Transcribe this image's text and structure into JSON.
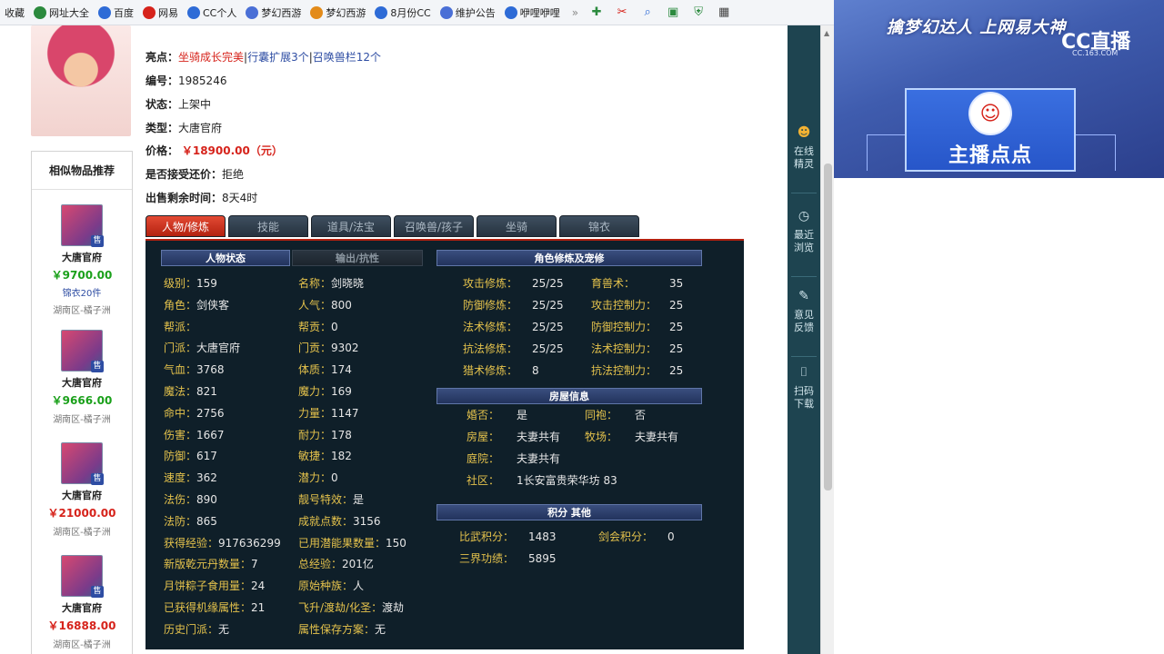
{
  "bookmarks": [
    {
      "label": "收藏",
      "icon": "star-icon",
      "color": "#888888"
    },
    {
      "label": "网址大全",
      "icon": "globe-icon",
      "color": "#2b8a3e"
    },
    {
      "label": "百度",
      "icon": "paw-icon",
      "color": "#2e6bd6"
    },
    {
      "label": "网易",
      "icon": "netease-icon",
      "color": "#d6231b"
    },
    {
      "label": "CC个人",
      "icon": "cc-icon",
      "color": "#2e6bd6"
    },
    {
      "label": "梦幻西游",
      "icon": "game-icon",
      "color": "#4a6fd6"
    },
    {
      "label": "梦幻西游",
      "icon": "game-icon",
      "color": "#e38b1a"
    },
    {
      "label": "8月份CC",
      "icon": "cc-icon",
      "color": "#2e6bd6"
    },
    {
      "label": "维护公告",
      "icon": "game-icon",
      "color": "#4a6fd6"
    },
    {
      "label": "咿哩咿哩",
      "icon": "tv-icon",
      "color": "#2e6bd6"
    }
  ],
  "bookmarks_more": "»",
  "item": {
    "highlights_label": "亮点：",
    "highlights": [
      {
        "text": "坐骑成长完美",
        "color": "red"
      },
      {
        "text": "|",
        "color": "plain"
      },
      {
        "text": "行囊扩展3个",
        "color": "blue"
      },
      {
        "text": "|",
        "color": "plain"
      },
      {
        "text": "召唤兽栏12个",
        "color": "blue"
      }
    ],
    "id_label": "编号：",
    "id": "1985246",
    "status_label": "状态：",
    "status": "上架中",
    "type_label": "类型：",
    "type": "大唐官府",
    "price_label": "价格：",
    "price": "￥18900.00（元）",
    "bargain_label": "是否接受还价：",
    "bargain": "拒绝",
    "remaining_label": "出售剩余时间：",
    "remaining": "8天4时"
  },
  "similar": {
    "title": "相似物品推荐",
    "badge": "售",
    "items": [
      {
        "name": "大唐官府",
        "price": "￥9700.00",
        "price_color": "#1aa01a",
        "extra": "锦衣20件",
        "server": "湖南区-橘子洲"
      },
      {
        "name": "大唐官府",
        "price": "￥9666.00",
        "price_color": "#1aa01a",
        "extra": "",
        "server": "湖南区-橘子洲"
      },
      {
        "name": "大唐官府",
        "price": "￥21000.00",
        "price_color": "#d6231b",
        "extra": "",
        "server": "湖南区-橘子洲"
      },
      {
        "name": "大唐官府",
        "price": "￥16888.00",
        "price_color": "#d6231b",
        "extra": "",
        "server": "湖南区-橘子洲"
      }
    ]
  },
  "tabs": [
    "人物/修炼",
    "技能",
    "道具/法宝",
    "召唤兽/孩子",
    "坐骑",
    "锦衣"
  ],
  "panel": {
    "status_head": "人物状态",
    "resist_head": "输出/抗性",
    "cultivation_head": "角色修炼及宠修",
    "house_head": "房屋信息",
    "points_head": "积分 其他",
    "left_fields": [
      [
        "级别：",
        "159"
      ],
      [
        "角色：",
        "剑侠客"
      ],
      [
        "帮派：",
        ""
      ],
      [
        "门派：",
        "大唐官府"
      ],
      [
        "气血：",
        "3768"
      ],
      [
        "魔法：",
        "821"
      ],
      [
        "命中：",
        "2756"
      ],
      [
        "伤害：",
        "1667"
      ],
      [
        "防御：",
        "617"
      ],
      [
        "速度：",
        "362"
      ],
      [
        "法伤：",
        "890"
      ],
      [
        "法防：",
        "865"
      ],
      [
        "获得经验：",
        "917636299"
      ],
      [
        "新版乾元丹数量：",
        "7"
      ],
      [
        "月饼粽子食用量：",
        "24"
      ],
      [
        "已获得机缘属性：",
        "21"
      ],
      [
        "历史门派：",
        "无"
      ]
    ],
    "mid_fields": [
      [
        "名称：",
        "剑晓晓"
      ],
      [
        "人气：",
        "800"
      ],
      [
        "帮贡：",
        "0"
      ],
      [
        "门贡：",
        "9302"
      ],
      [
        "体质：",
        "174"
      ],
      [
        "魔力：",
        "169"
      ],
      [
        "力量：",
        "1147"
      ],
      [
        "耐力：",
        "178"
      ],
      [
        "敏捷：",
        "182"
      ],
      [
        "潜力：",
        "0"
      ],
      [
        "靓号特效：",
        "是"
      ],
      [
        "成就点数：",
        "3156"
      ],
      [
        "已用潜能果数量：",
        "150"
      ],
      [
        "总经验：",
        "201亿"
      ],
      [
        "原始种族：",
        "人"
      ],
      [
        "飞升/渡劫/化圣：",
        "渡劫"
      ],
      [
        "属性保存方案：",
        "无"
      ]
    ],
    "cultivation_left": [
      [
        "攻击修炼：",
        "25/25"
      ],
      [
        "防御修炼：",
        "25/25"
      ],
      [
        "法术修炼：",
        "25/25"
      ],
      [
        "抗法修炼：",
        "25/25"
      ],
      [
        "猎术修炼：",
        "8"
      ]
    ],
    "cultivation_right": [
      [
        "育兽术：",
        "35"
      ],
      [
        "攻击控制力：",
        "25"
      ],
      [
        "防御控制力：",
        "25"
      ],
      [
        "法术控制力：",
        "25"
      ],
      [
        "抗法控制力：",
        "25"
      ]
    ],
    "house_fields": [
      [
        "婚否：",
        "是"
      ],
      [
        "同袍：",
        "否"
      ],
      [
        "房屋：",
        "夫妻共有"
      ],
      [
        "牧场：",
        "夫妻共有"
      ],
      [
        "庭院：",
        "夫妻共有"
      ],
      [
        "社区：",
        "1长安富贵荣华坊 83"
      ]
    ],
    "points_fields": [
      [
        "比武积分：",
        "1483"
      ],
      [
        "剑会积分：",
        "0"
      ],
      [
        "三界功绩：",
        "5895"
      ]
    ]
  },
  "toolbar_strip": [
    {
      "label": "在线\n精灵",
      "icon": "sprite-icon"
    },
    {
      "label": "最近\n浏览",
      "icon": "clock-icon"
    },
    {
      "label": "意见\n反馈",
      "icon": "edit-icon"
    },
    {
      "label": "扫码\n下载",
      "icon": "scan-icon"
    }
  ],
  "cc": {
    "banner": "擒梦幻达人 上网易大神",
    "logo": "CC直播",
    "url": "CC.163.COM",
    "host": "主播点点"
  }
}
